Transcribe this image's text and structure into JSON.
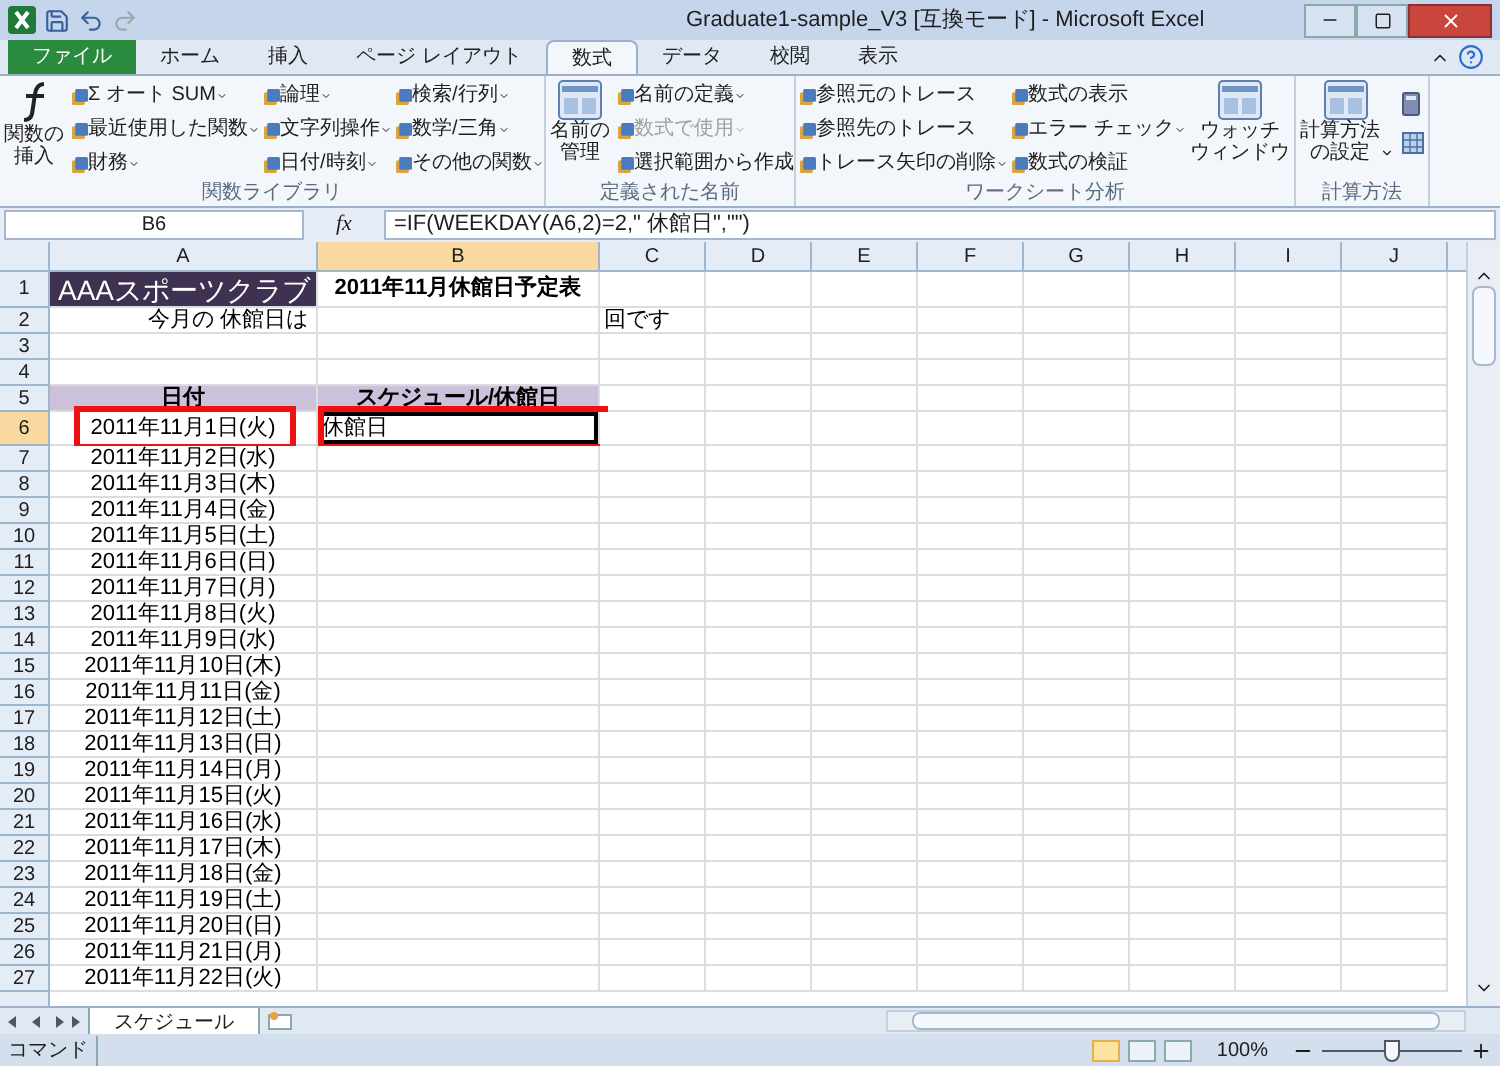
{
  "window": {
    "title": "Graduate1-sample_V3  [互換モード]  -  Microsoft Excel"
  },
  "tabs": [
    {
      "label": "ファイル",
      "kind": "file",
      "selected": false
    },
    {
      "label": "ホーム",
      "kind": "tab",
      "selected": false
    },
    {
      "label": "挿入",
      "kind": "tab",
      "selected": false
    },
    {
      "label": "ページ レイアウト",
      "kind": "tab",
      "selected": false
    },
    {
      "label": "数式",
      "kind": "tab",
      "selected": true
    },
    {
      "label": "データ",
      "kind": "tab",
      "selected": false
    },
    {
      "label": "校閲",
      "kind": "tab",
      "selected": false
    },
    {
      "label": "表示",
      "kind": "tab",
      "selected": false
    }
  ],
  "ribbon_groups": [
    {
      "label": "関数ライブラリ",
      "controls": [
        {
          "kind": "large",
          "lines": [
            "関数の",
            "挿入"
          ],
          "dropdown": false
        },
        {
          "kind": "stack",
          "items": [
            {
              "label": "Σ オート SUM",
              "dropdown": true,
              "disabled": false
            },
            {
              "label": "最近使用した関数",
              "dropdown": true,
              "disabled": false
            },
            {
              "label": "財務",
              "dropdown": true,
              "disabled": false
            }
          ]
        },
        {
          "kind": "stack",
          "items": [
            {
              "label": "論理",
              "dropdown": true,
              "disabled": false
            },
            {
              "label": "文字列操作",
              "dropdown": true,
              "disabled": false
            },
            {
              "label": "日付/時刻",
              "dropdown": true,
              "disabled": false
            }
          ]
        },
        {
          "kind": "stack",
          "items": [
            {
              "label": "検索/行列",
              "dropdown": true,
              "disabled": false
            },
            {
              "label": "数学/三角",
              "dropdown": true,
              "disabled": false
            },
            {
              "label": "その他の関数",
              "dropdown": true,
              "disabled": false
            }
          ]
        }
      ]
    },
    {
      "label": "定義された名前",
      "controls": [
        {
          "kind": "large",
          "lines": [
            "名前の",
            "管理"
          ],
          "dropdown": false
        },
        {
          "kind": "stack",
          "items": [
            {
              "label": "名前の定義",
              "dropdown": true,
              "disabled": false
            },
            {
              "label": "数式で使用",
              "dropdown": true,
              "disabled": true
            },
            {
              "label": "選択範囲から作成",
              "dropdown": false,
              "disabled": false
            }
          ]
        }
      ]
    },
    {
      "label": "ワークシート分析",
      "controls": [
        {
          "kind": "stack",
          "items": [
            {
              "label": "参照元のトレース",
              "dropdown": false,
              "disabled": false
            },
            {
              "label": "参照先のトレース",
              "dropdown": false,
              "disabled": false
            },
            {
              "label": "トレース矢印の削除",
              "dropdown": true,
              "disabled": false
            }
          ]
        },
        {
          "kind": "stack",
          "items": [
            {
              "label": "数式の表示",
              "dropdown": false,
              "disabled": false
            },
            {
              "label": "エラー チェック",
              "dropdown": true,
              "disabled": false
            },
            {
              "label": "数式の検証",
              "dropdown": false,
              "disabled": false
            }
          ]
        },
        {
          "kind": "large",
          "lines": [
            "ウォッチ",
            "ウィンドウ"
          ],
          "dropdown": false
        }
      ]
    },
    {
      "label": "計算方法",
      "controls": [
        {
          "kind": "large",
          "lines": [
            "計算方法",
            "の設定"
          ],
          "dropdown": true
        }
      ]
    }
  ],
  "formula_bar": {
    "name_box": "B6",
    "fx_label": "fx",
    "formula": "=IF(WEEKDAY(A6,2)=2,\" 休館日\",\"\")"
  },
  "columns": [
    {
      "label": "A",
      "selected": false
    },
    {
      "label": "B",
      "selected": true
    },
    {
      "label": "C",
      "selected": false
    },
    {
      "label": "D",
      "selected": false
    },
    {
      "label": "E",
      "selected": false
    },
    {
      "label": "F",
      "selected": false
    },
    {
      "label": "G",
      "selected": false
    },
    {
      "label": "H",
      "selected": false
    },
    {
      "label": "I",
      "selected": false
    },
    {
      "label": "J",
      "selected": false
    }
  ],
  "rows": [
    {
      "number": "1",
      "kind": "title",
      "selected": false,
      "highlighted": false,
      "cells": {
        "A": "AAAスポーツクラブ",
        "B": "2011年11月休館日予定表"
      }
    },
    {
      "number": "2",
      "kind": "label",
      "selected": false,
      "highlighted": false,
      "cells": {
        "A": "今月の 休館日は",
        "C": "回です"
      }
    },
    {
      "number": "3",
      "kind": "data",
      "selected": false,
      "highlighted": false,
      "cells": {}
    },
    {
      "number": "4",
      "kind": "data",
      "selected": false,
      "highlighted": false,
      "cells": {}
    },
    {
      "number": "5",
      "kind": "header",
      "selected": false,
      "highlighted": false,
      "cells": {
        "A": "日付",
        "B": "スケジュール/休館日"
      }
    },
    {
      "number": "6",
      "kind": "data",
      "selected": true,
      "highlighted": true,
      "cells": {
        "A": "2011年11月1日(火)",
        "B": "休館日"
      }
    },
    {
      "number": "7",
      "kind": "data",
      "selected": false,
      "highlighted": false,
      "cells": {
        "A": "2011年11月2日(水)"
      }
    },
    {
      "number": "8",
      "kind": "data",
      "selected": false,
      "highlighted": false,
      "cells": {
        "A": "2011年11月3日(木)"
      }
    },
    {
      "number": "9",
      "kind": "data",
      "selected": false,
      "highlighted": false,
      "cells": {
        "A": "2011年11月4日(金)"
      }
    },
    {
      "number": "10",
      "kind": "data",
      "selected": false,
      "highlighted": false,
      "cells": {
        "A": "2011年11月5日(土)"
      }
    },
    {
      "number": "11",
      "kind": "data",
      "selected": false,
      "highlighted": false,
      "cells": {
        "A": "2011年11月6日(日)"
      }
    },
    {
      "number": "12",
      "kind": "data",
      "selected": false,
      "highlighted": false,
      "cells": {
        "A": "2011年11月7日(月)"
      }
    },
    {
      "number": "13",
      "kind": "data",
      "selected": false,
      "highlighted": false,
      "cells": {
        "A": "2011年11月8日(火)"
      }
    },
    {
      "number": "14",
      "kind": "data",
      "selected": false,
      "highlighted": false,
      "cells": {
        "A": "2011年11月9日(水)"
      }
    },
    {
      "number": "15",
      "kind": "data",
      "selected": false,
      "highlighted": false,
      "cells": {
        "A": "2011年11月10日(木)"
      }
    },
    {
      "number": "16",
      "kind": "data",
      "selected": false,
      "highlighted": false,
      "cells": {
        "A": "2011年11月11日(金)"
      }
    },
    {
      "number": "17",
      "kind": "data",
      "selected": false,
      "highlighted": false,
      "cells": {
        "A": "2011年11月12日(土)"
      }
    },
    {
      "number": "18",
      "kind": "data",
      "selected": false,
      "highlighted": false,
      "cells": {
        "A": "2011年11月13日(日)"
      }
    },
    {
      "number": "19",
      "kind": "data",
      "selected": false,
      "highlighted": false,
      "cells": {
        "A": "2011年11月14日(月)"
      }
    },
    {
      "number": "20",
      "kind": "data",
      "selected": false,
      "highlighted": false,
      "cells": {
        "A": "2011年11月15日(火)"
      }
    },
    {
      "number": "21",
      "kind": "data",
      "selected": false,
      "highlighted": false,
      "cells": {
        "A": "2011年11月16日(水)"
      }
    },
    {
      "number": "22",
      "kind": "data",
      "selected": false,
      "highlighted": false,
      "cells": {
        "A": "2011年11月17日(木)"
      }
    },
    {
      "number": "23",
      "kind": "data",
      "selected": false,
      "highlighted": false,
      "cells": {
        "A": "2011年11月18日(金)"
      }
    },
    {
      "number": "24",
      "kind": "data",
      "selected": false,
      "highlighted": false,
      "cells": {
        "A": "2011年11月19日(土)"
      }
    },
    {
      "number": "25",
      "kind": "data",
      "selected": false,
      "highlighted": false,
      "cells": {
        "A": "2011年11月20日(日)"
      }
    },
    {
      "number": "26",
      "kind": "data",
      "selected": false,
      "highlighted": false,
      "cells": {
        "A": "2011年11月21日(月)"
      }
    },
    {
      "number": "27",
      "kind": "data",
      "selected": false,
      "highlighted": false,
      "cells": {
        "A": "2011年11月22日(火)"
      }
    }
  ],
  "sheet_tabs": [
    {
      "label": "スケジュール",
      "selected": true
    }
  ],
  "status_bar": {
    "mode": "コマンド",
    "zoom": "100%",
    "zoom_slider": {
      "level": 0.5
    }
  }
}
